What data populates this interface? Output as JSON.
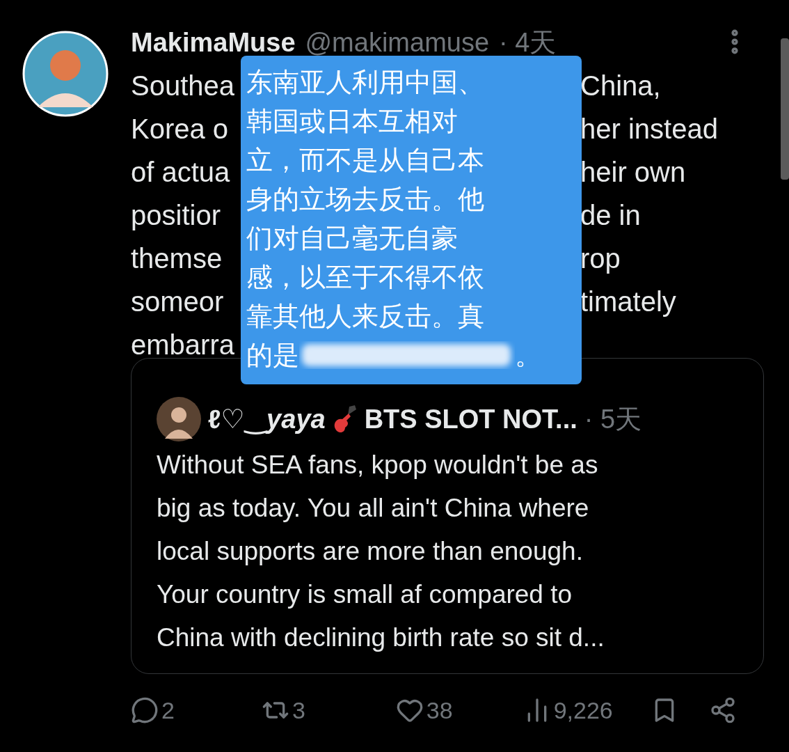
{
  "tweet": {
    "display_name": "MakimaMuse",
    "handle": "@makimamuse",
    "time": "· 4天",
    "lines": [
      {
        "left": "Southea",
        "right": "China,"
      },
      {
        "left": "Korea o",
        "right": "her instead"
      },
      {
        "left": "of actua",
        "right": "heir own"
      },
      {
        "left": "positior",
        "right": "de in"
      },
      {
        "left": "themse",
        "right": "rop"
      },
      {
        "left": "someor",
        "right": "timately"
      },
      {
        "left": "embarra"
      }
    ]
  },
  "translation": {
    "lines": [
      "东南亚人利用中国、",
      "韩国或日本互相对",
      "立，而不是从自己本",
      "身的立场去反击。他",
      "们对自己毫无自豪",
      "感，以至于不得不依",
      "靠其他人来反击。真"
    ],
    "last_before": "的是",
    "last_after": "。"
  },
  "quote": {
    "name_prefix": "ℓ♡‿*yaya*",
    "name_rest": "BTS SLOT NOT...",
    "time": "· 5天",
    "lines": [
      "Without SEA fans, kpop wouldn't be as",
      "big as today. You all ain't China where",
      "local supports are more than enough.",
      "Your country is small af compared to",
      "China with declining birth rate so sit d..."
    ]
  },
  "actions": [
    {
      "kind": "reply",
      "count": "2"
    },
    {
      "kind": "repost",
      "count": "3"
    },
    {
      "kind": "like",
      "count": "38"
    },
    {
      "kind": "views",
      "count": "9,226"
    },
    {
      "kind": "bookmark"
    },
    {
      "kind": "share"
    }
  ]
}
